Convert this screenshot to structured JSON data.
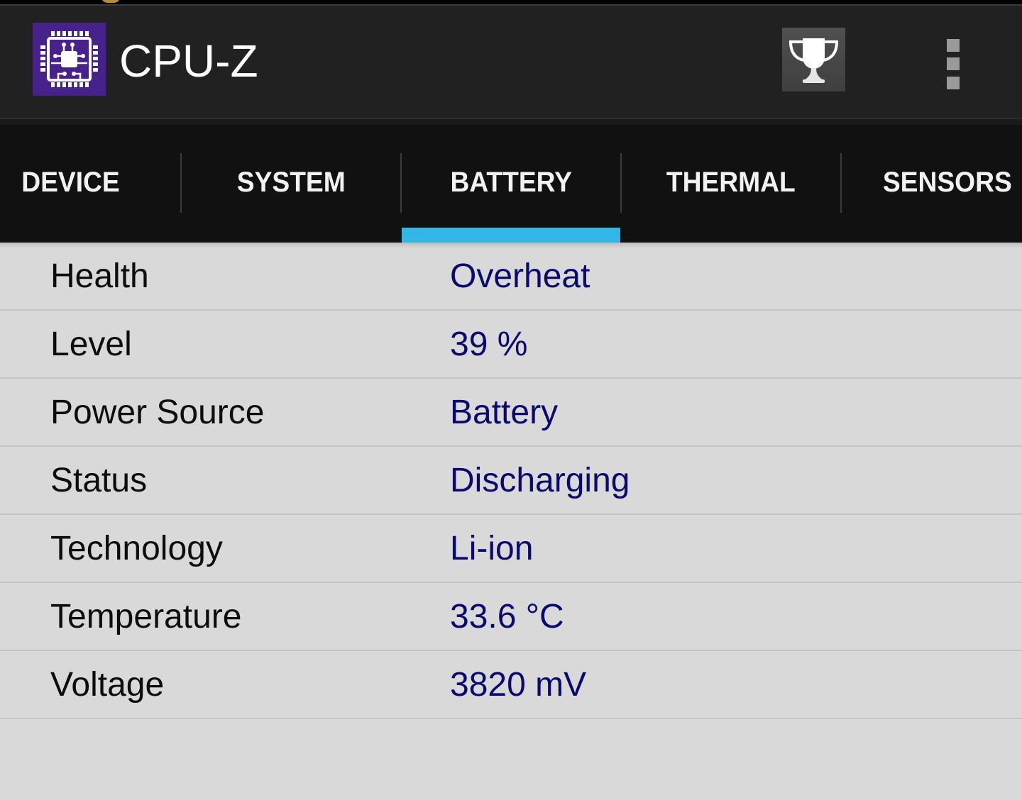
{
  "app": {
    "title": "CPU-Z",
    "logo_icon": "cpu-chip-icon",
    "actions": [
      {
        "name": "benchmark",
        "icon": "trophy-icon"
      },
      {
        "name": "overflow-menu",
        "icon": "more-vertical-icon"
      }
    ]
  },
  "tabs": [
    {
      "label": "DEVICE",
      "active": false
    },
    {
      "label": "SYSTEM",
      "active": false
    },
    {
      "label": "BATTERY",
      "active": true
    },
    {
      "label": "THERMAL",
      "active": false
    },
    {
      "label": "SENSORS",
      "active": false
    }
  ],
  "colors": {
    "accent": "#33b5e5",
    "logo_background": "#46228a",
    "value_text": "#0a0a6e",
    "app_bar": "#212121",
    "tab_bar": "#111111",
    "content_background": "#d9d9d9"
  },
  "battery": {
    "rows": [
      {
        "label": "Health",
        "value": "Overheat"
      },
      {
        "label": "Level",
        "value": "39 %"
      },
      {
        "label": "Power Source",
        "value": "Battery"
      },
      {
        "label": "Status",
        "value": "Discharging"
      },
      {
        "label": "Technology",
        "value": "Li-ion"
      },
      {
        "label": "Temperature",
        "value": "33.6 °C"
      },
      {
        "label": "Voltage",
        "value": "3820 mV"
      }
    ]
  }
}
